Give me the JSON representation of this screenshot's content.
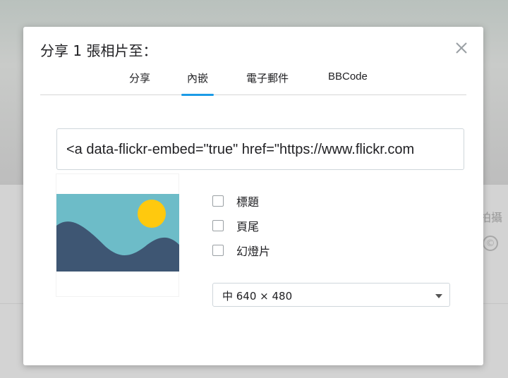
{
  "background": {
    "side_text": "拍攝",
    "cc_symbol": "©"
  },
  "modal": {
    "title": "分享 1 張相片至：",
    "close_glyph": "×",
    "tabs": [
      {
        "label": "分享",
        "active": false
      },
      {
        "label": "內嵌",
        "active": true
      },
      {
        "label": "電子郵件",
        "active": false
      },
      {
        "label": "BBCode",
        "active": false
      }
    ],
    "embed_code": "<a data-flickr-embed=\"true\"  href=\"https://www.flickr.com",
    "options": [
      {
        "label": "標題",
        "checked": false
      },
      {
        "label": "頁尾",
        "checked": false
      },
      {
        "label": "幻燈片",
        "checked": false
      }
    ],
    "size_select": {
      "value": "中 640 × 480"
    }
  },
  "colors": {
    "accent": "#1c9be6",
    "sky": "#6dbcc8",
    "sun": "#ffc90e",
    "mountain": "#3e5673"
  },
  "icons": {
    "close": "close-icon",
    "image_placeholder": "image-placeholder-icon",
    "dropdown": "chevron-down-icon"
  }
}
